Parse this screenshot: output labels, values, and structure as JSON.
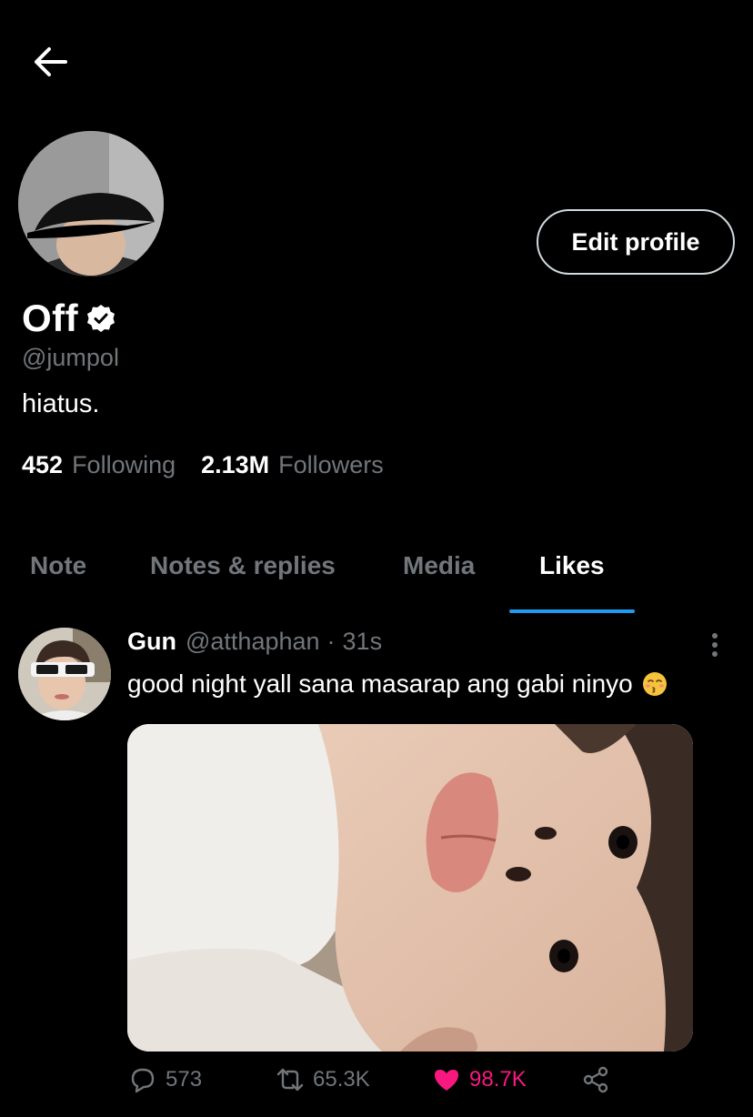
{
  "profile": {
    "name": "Off",
    "handle": "@jumpol",
    "bio": "hiatus.",
    "following_count": "452",
    "following_label": "Following",
    "followers_count": "2.13M",
    "followers_label": "Followers",
    "edit_label": "Edit profile"
  },
  "tabs": [
    {
      "label": "Note"
    },
    {
      "label": "Notes & replies"
    },
    {
      "label": "Media"
    },
    {
      "label": "Likes"
    }
  ],
  "active_tab": "Likes",
  "tweet": {
    "author": "Gun",
    "handle": "@atthaphan",
    "separator": "·",
    "time": "31s",
    "text": "good night yall sana masarap ang gabi ninyo",
    "emoji": "kissing-face-emoji",
    "replies": "573",
    "retweets": "65.3K",
    "likes": "98.7K"
  },
  "colors": {
    "background": "#000000",
    "accent": "#1d9bf0",
    "muted": "#71767b",
    "like": "#f91880"
  },
  "icons": [
    "back-arrow-icon",
    "verified-badge-icon",
    "more-options-icon",
    "reply-icon",
    "retweet-icon",
    "like-heart-icon",
    "share-icon"
  ]
}
